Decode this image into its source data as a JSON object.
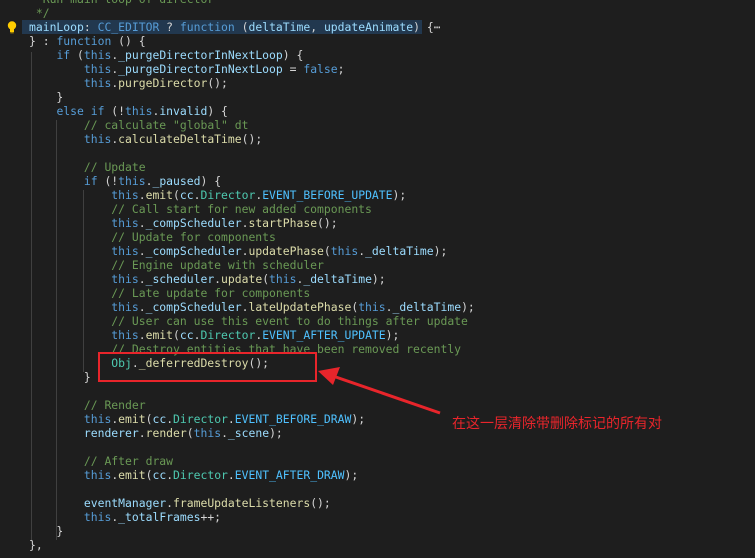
{
  "colors": {
    "background": "#1e1e1e",
    "keyword": "#569cd6",
    "function": "#dcdcaa",
    "property": "#9cdcfe",
    "class": "#4ec9b0",
    "comment": "#6a9955",
    "string": "#ce9178",
    "constant": "#4fc1ff",
    "default": "#d4d4d4",
    "annotation_red": "#e8252b"
  },
  "icons": {
    "lightbulb": "lightbulb-icon",
    "fold": "ellipsis-icon"
  },
  "annotation_text": "在这一层清除带删除标记的所有对",
  "code_lines": [
    {
      "t": [
        [
          "  Run main loop of director",
          "c"
        ]
      ]
    },
    {
      "t": [
        [
          " */",
          "c"
        ]
      ]
    },
    {
      "t": [
        [
          "mainLoop",
          "p"
        ],
        [
          ": ",
          "d"
        ],
        [
          "CC_EDITOR",
          "k"
        ],
        [
          " ? ",
          "d"
        ],
        [
          "function",
          "k"
        ],
        [
          " (",
          "d"
        ],
        [
          "deltaTime",
          "p"
        ],
        [
          ", ",
          "d"
        ],
        [
          "updateAnimate",
          "p"
        ],
        [
          ") {",
          "d"
        ],
        [
          "⋯",
          "d"
        ]
      ]
    },
    {
      "t": [
        [
          "} : ",
          "d"
        ],
        [
          "function",
          "k"
        ],
        [
          " () {",
          "d"
        ]
      ]
    },
    {
      "t": [
        [
          "    ",
          "d"
        ],
        [
          "if",
          "k"
        ],
        [
          " (",
          "d"
        ],
        [
          "this",
          "k"
        ],
        [
          ".",
          "d"
        ],
        [
          "_purgeDirectorInNextLoop",
          "p"
        ],
        [
          ") {",
          "d"
        ]
      ]
    },
    {
      "t": [
        [
          "        ",
          "d"
        ],
        [
          "this",
          "k"
        ],
        [
          ".",
          "d"
        ],
        [
          "_purgeDirectorInNextLoop",
          "p"
        ],
        [
          " = ",
          "d"
        ],
        [
          "false",
          "k"
        ],
        [
          ";",
          "d"
        ]
      ]
    },
    {
      "t": [
        [
          "        ",
          "d"
        ],
        [
          "this",
          "k"
        ],
        [
          ".",
          "d"
        ],
        [
          "purgeDirector",
          "f"
        ],
        [
          "();",
          "d"
        ]
      ]
    },
    {
      "t": [
        [
          "    }",
          "d"
        ]
      ]
    },
    {
      "t": [
        [
          "    ",
          "d"
        ],
        [
          "else",
          "k"
        ],
        [
          " ",
          "d"
        ],
        [
          "if",
          "k"
        ],
        [
          " (!",
          "d"
        ],
        [
          "this",
          "k"
        ],
        [
          ".",
          "d"
        ],
        [
          "invalid",
          "p"
        ],
        [
          ") {",
          "d"
        ]
      ]
    },
    {
      "t": [
        [
          "        ",
          "d"
        ],
        [
          "// calculate \"global\" dt",
          "c"
        ]
      ]
    },
    {
      "t": [
        [
          "        ",
          "d"
        ],
        [
          "this",
          "k"
        ],
        [
          ".",
          "d"
        ],
        [
          "calculateDeltaTime",
          "f"
        ],
        [
          "();",
          "d"
        ]
      ]
    },
    {
      "t": [
        [
          "",
          "d"
        ]
      ]
    },
    {
      "t": [
        [
          "        ",
          "d"
        ],
        [
          "// Update",
          "c"
        ]
      ]
    },
    {
      "t": [
        [
          "        ",
          "d"
        ],
        [
          "if",
          "k"
        ],
        [
          " (!",
          "d"
        ],
        [
          "this",
          "k"
        ],
        [
          ".",
          "d"
        ],
        [
          "_paused",
          "p"
        ],
        [
          ") {",
          "d"
        ]
      ]
    },
    {
      "t": [
        [
          "            ",
          "d"
        ],
        [
          "this",
          "k"
        ],
        [
          ".",
          "d"
        ],
        [
          "emit",
          "f"
        ],
        [
          "(",
          "d"
        ],
        [
          "cc",
          "p"
        ],
        [
          ".",
          "d"
        ],
        [
          "Director",
          "n"
        ],
        [
          ".",
          "d"
        ],
        [
          "EVENT_BEFORE_UPDATE",
          "o"
        ],
        [
          ");",
          "d"
        ]
      ]
    },
    {
      "t": [
        [
          "            ",
          "d"
        ],
        [
          "// Call start for new added components",
          "c"
        ]
      ]
    },
    {
      "t": [
        [
          "            ",
          "d"
        ],
        [
          "this",
          "k"
        ],
        [
          ".",
          "d"
        ],
        [
          "_compScheduler",
          "p"
        ],
        [
          ".",
          "d"
        ],
        [
          "startPhase",
          "f"
        ],
        [
          "();",
          "d"
        ]
      ]
    },
    {
      "t": [
        [
          "            ",
          "d"
        ],
        [
          "// Update for components",
          "c"
        ]
      ]
    },
    {
      "t": [
        [
          "            ",
          "d"
        ],
        [
          "this",
          "k"
        ],
        [
          ".",
          "d"
        ],
        [
          "_compScheduler",
          "p"
        ],
        [
          ".",
          "d"
        ],
        [
          "updatePhase",
          "f"
        ],
        [
          "(",
          "d"
        ],
        [
          "this",
          "k"
        ],
        [
          ".",
          "d"
        ],
        [
          "_deltaTime",
          "p"
        ],
        [
          ");",
          "d"
        ]
      ]
    },
    {
      "t": [
        [
          "            ",
          "d"
        ],
        [
          "// Engine update with scheduler",
          "c"
        ]
      ]
    },
    {
      "t": [
        [
          "            ",
          "d"
        ],
        [
          "this",
          "k"
        ],
        [
          ".",
          "d"
        ],
        [
          "_scheduler",
          "p"
        ],
        [
          ".",
          "d"
        ],
        [
          "update",
          "f"
        ],
        [
          "(",
          "d"
        ],
        [
          "this",
          "k"
        ],
        [
          ".",
          "d"
        ],
        [
          "_deltaTime",
          "p"
        ],
        [
          ");",
          "d"
        ]
      ]
    },
    {
      "t": [
        [
          "            ",
          "d"
        ],
        [
          "// Late update for components",
          "c"
        ]
      ]
    },
    {
      "t": [
        [
          "            ",
          "d"
        ],
        [
          "this",
          "k"
        ],
        [
          ".",
          "d"
        ],
        [
          "_compScheduler",
          "p"
        ],
        [
          ".",
          "d"
        ],
        [
          "lateUpdatePhase",
          "f"
        ],
        [
          "(",
          "d"
        ],
        [
          "this",
          "k"
        ],
        [
          ".",
          "d"
        ],
        [
          "_deltaTime",
          "p"
        ],
        [
          ");",
          "d"
        ]
      ]
    },
    {
      "t": [
        [
          "            ",
          "d"
        ],
        [
          "// User can use this event to do things after update",
          "c"
        ]
      ]
    },
    {
      "t": [
        [
          "            ",
          "d"
        ],
        [
          "this",
          "k"
        ],
        [
          ".",
          "d"
        ],
        [
          "emit",
          "f"
        ],
        [
          "(",
          "d"
        ],
        [
          "cc",
          "p"
        ],
        [
          ".",
          "d"
        ],
        [
          "Director",
          "n"
        ],
        [
          ".",
          "d"
        ],
        [
          "EVENT_AFTER_UPDATE",
          "o"
        ],
        [
          ");",
          "d"
        ]
      ]
    },
    {
      "t": [
        [
          "            ",
          "d"
        ],
        [
          "// Destroy entities that have been removed recently",
          "c"
        ]
      ]
    },
    {
      "t": [
        [
          "            ",
          "d"
        ],
        [
          "Obj",
          "n"
        ],
        [
          ".",
          "d"
        ],
        [
          "_deferredDestroy",
          "f"
        ],
        [
          "();",
          "d"
        ]
      ]
    },
    {
      "t": [
        [
          "        }",
          "d"
        ]
      ]
    },
    {
      "t": [
        [
          "",
          "d"
        ]
      ]
    },
    {
      "t": [
        [
          "        ",
          "d"
        ],
        [
          "// Render",
          "c"
        ]
      ]
    },
    {
      "t": [
        [
          "        ",
          "d"
        ],
        [
          "this",
          "k"
        ],
        [
          ".",
          "d"
        ],
        [
          "emit",
          "f"
        ],
        [
          "(",
          "d"
        ],
        [
          "cc",
          "p"
        ],
        [
          ".",
          "d"
        ],
        [
          "Director",
          "n"
        ],
        [
          ".",
          "d"
        ],
        [
          "EVENT_BEFORE_DRAW",
          "o"
        ],
        [
          ");",
          "d"
        ]
      ]
    },
    {
      "t": [
        [
          "        ",
          "d"
        ],
        [
          "renderer",
          "p"
        ],
        [
          ".",
          "d"
        ],
        [
          "render",
          "f"
        ],
        [
          "(",
          "d"
        ],
        [
          "this",
          "k"
        ],
        [
          ".",
          "d"
        ],
        [
          "_scene",
          "p"
        ],
        [
          ");",
          "d"
        ]
      ]
    },
    {
      "t": [
        [
          "",
          "d"
        ]
      ]
    },
    {
      "t": [
        [
          "        ",
          "d"
        ],
        [
          "// After draw",
          "c"
        ]
      ]
    },
    {
      "t": [
        [
          "        ",
          "d"
        ],
        [
          "this",
          "k"
        ],
        [
          ".",
          "d"
        ],
        [
          "emit",
          "f"
        ],
        [
          "(",
          "d"
        ],
        [
          "cc",
          "p"
        ],
        [
          ".",
          "d"
        ],
        [
          "Director",
          "n"
        ],
        [
          ".",
          "d"
        ],
        [
          "EVENT_AFTER_DRAW",
          "o"
        ],
        [
          ");",
          "d"
        ]
      ]
    },
    {
      "t": [
        [
          "",
          "d"
        ]
      ]
    },
    {
      "t": [
        [
          "        ",
          "d"
        ],
        [
          "eventManager",
          "p"
        ],
        [
          ".",
          "d"
        ],
        [
          "frameUpdateListeners",
          "f"
        ],
        [
          "();",
          "d"
        ]
      ]
    },
    {
      "t": [
        [
          "        ",
          "d"
        ],
        [
          "this",
          "k"
        ],
        [
          ".",
          "d"
        ],
        [
          "_totalFrames",
          "p"
        ],
        [
          "++;",
          "d"
        ]
      ]
    },
    {
      "t": [
        [
          "    }",
          "d"
        ]
      ]
    },
    {
      "t": [
        [
          "},",
          "d"
        ]
      ]
    }
  ]
}
